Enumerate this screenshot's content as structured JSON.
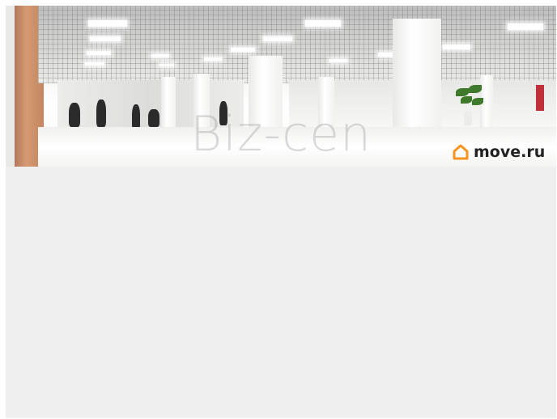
{
  "photo": {
    "watermark_text": "Biz-cen",
    "logo_text": "move.ru",
    "logo_icon": "house-icon",
    "logo_color": "#f7941d"
  },
  "colors": {
    "placeholder_background": "#efefef",
    "page_background": "#ffffff"
  }
}
